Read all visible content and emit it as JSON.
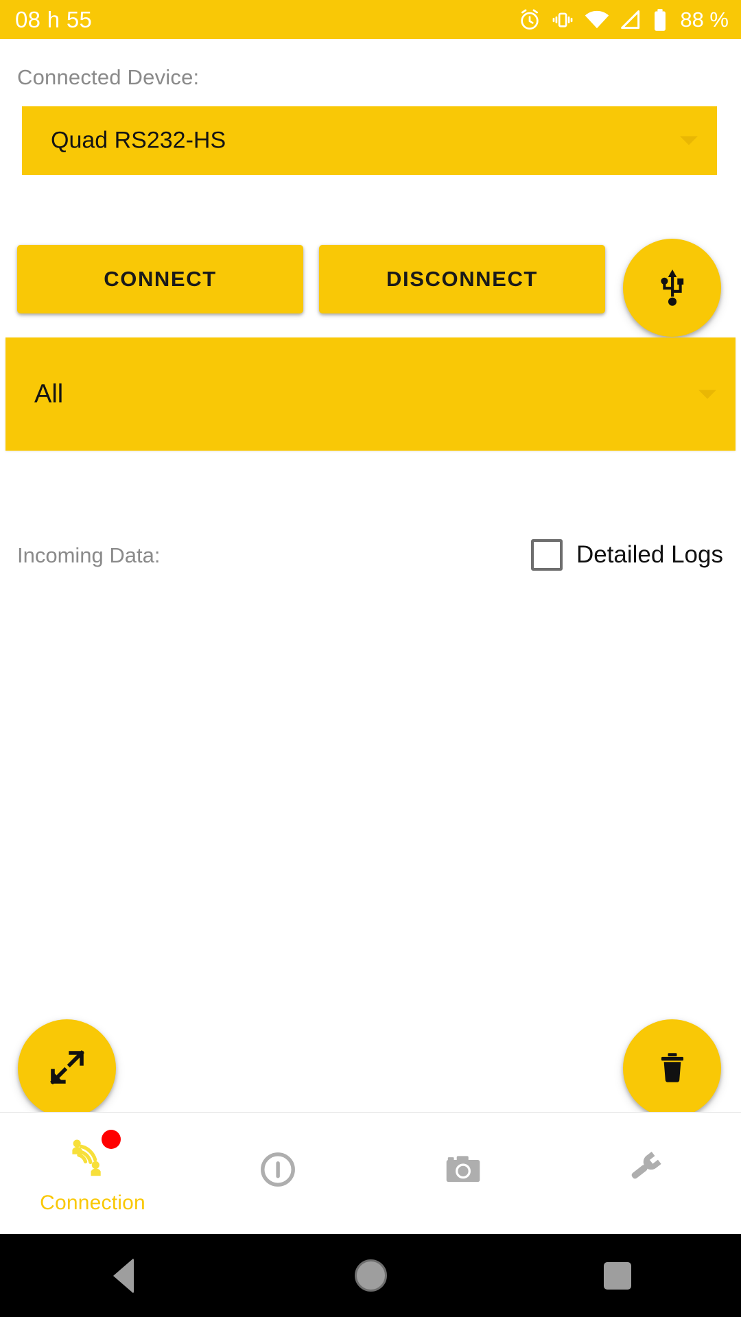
{
  "status_bar": {
    "time": "08 h 55",
    "battery_percent": "88 %",
    "icons": [
      "alarm-icon",
      "vibrate-icon",
      "wifi-icon",
      "cellular-signal-icon",
      "battery-icon"
    ],
    "background_color": "#F9C806",
    "text_color": "#FFFFFF"
  },
  "screen": {
    "connected_device_label": "Connected Device:",
    "device_value": "Quad RS232-HS",
    "filter_value": "All",
    "incoming_data_label": "Incoming Data:",
    "detailed_logs_label": "Detailed Logs",
    "detailed_logs_checked": false,
    "log_text": ""
  },
  "buttons": {
    "connect": "CONNECT",
    "disconnect": "DISCONNECT",
    "usb_fab": "usb-icon",
    "expand_fab": "expand-icon",
    "trash_fab": "trash-icon"
  },
  "bottom_nav": {
    "items": [
      {
        "label": "Connection",
        "icon": "connection-share-icon",
        "active": true,
        "badge": true
      },
      {
        "label": "",
        "icon": "info-icon",
        "active": false,
        "badge": false
      },
      {
        "label": "",
        "icon": "camera-icon",
        "active": false,
        "badge": false
      },
      {
        "label": "",
        "icon": "wrench-icon",
        "active": false,
        "badge": false
      }
    ]
  },
  "android_nav": {
    "back": "back-triangle-icon",
    "home": "home-circle-icon",
    "recents": "recents-square-icon"
  },
  "colors": {
    "accent": "#F9C806",
    "badge": "#FF0000",
    "muted_text": "#8A8A8A",
    "nav_inactive": "#AEAEAE"
  }
}
